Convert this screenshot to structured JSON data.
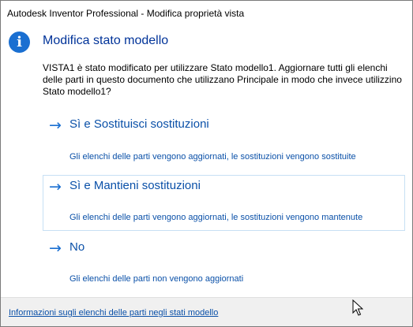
{
  "window": {
    "title": "Autodesk Inventor Professional - Modifica proprietà vista"
  },
  "dialog": {
    "main_instruction": "Modifica stato modello",
    "content": "VISTA1 è stato modificato per utilizzare Stato modello1. Aggiornare tutti gli elenchi delle parti in questo documento che utilizzano Principale in modo che invece utilizzino Stato modello1?",
    "icon": "info-icon",
    "commands": [
      {
        "arrow": "→",
        "label": "Sì e Sostituisci sostituzioni",
        "note": "Gli elenchi delle parti vengono aggiornati, le sostituzioni vengono sostituite"
      },
      {
        "arrow": "→",
        "label": "Sì e Mantieni sostituzioni",
        "note": "Gli elenchi delle parti vengono aggiornati, le sostituzioni vengono mantenute"
      },
      {
        "arrow": "→",
        "label": "No",
        "note": "Gli elenchi delle parti non vengono aggiornati"
      }
    ],
    "footer_link": "Informazioni sugli elenchi delle parti negli stati modello"
  },
  "colors": {
    "accent": "#1a6fd1",
    "link": "#0a50a8",
    "heading": "#003399",
    "hover_border": "#c7e0f4"
  }
}
